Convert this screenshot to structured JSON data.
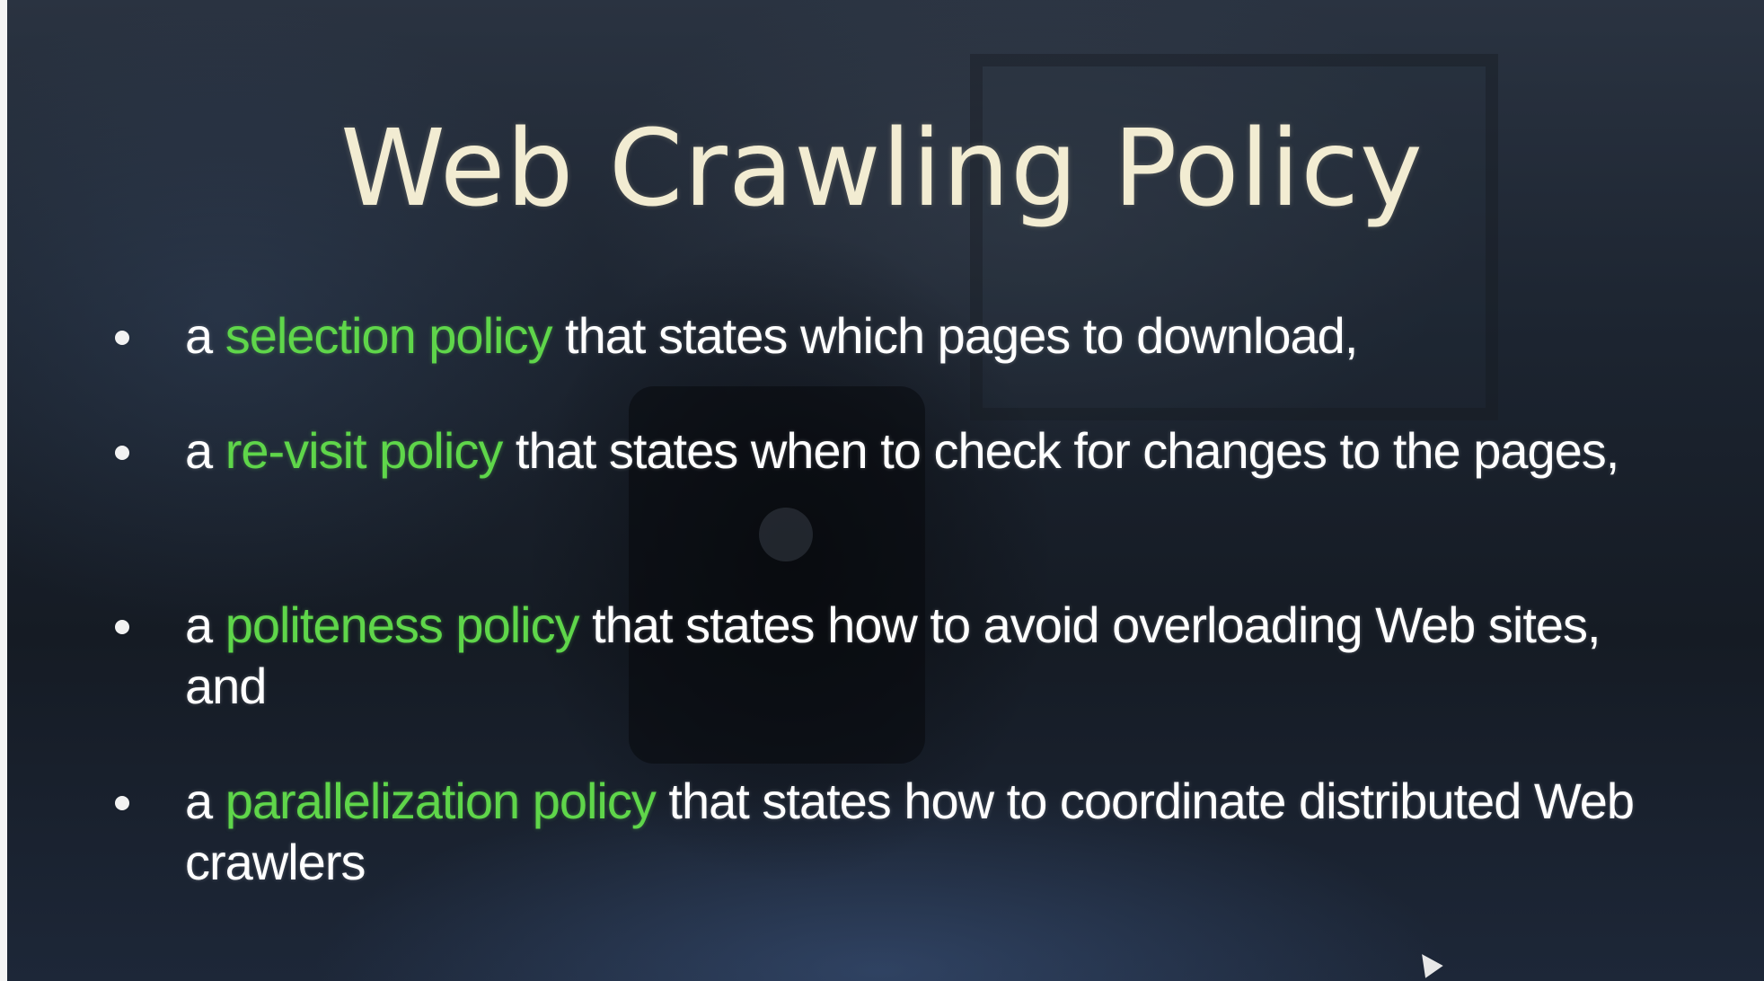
{
  "slide": {
    "title": "Web Crawling Policy",
    "bullets": [
      {
        "prefix": "a ",
        "highlight": "selection policy",
        "rest": " that states which pages to download,"
      },
      {
        "prefix": "a ",
        "highlight": "re-visit policy",
        "rest": " that states when to check for changes to the pages,"
      },
      {
        "prefix": "a ",
        "highlight": "politeness policy",
        "rest": " that states how to avoid overloading Web sites, and"
      },
      {
        "prefix": "a ",
        "highlight": "parallelization policy",
        "rest": " that states how to coordinate distributed Web crawlers"
      }
    ]
  },
  "colors": {
    "title": "#f2ecd2",
    "body_text": "#ffffff",
    "highlight": "#5fd64a",
    "background": "#1c2430"
  },
  "icons": {
    "bullet": "bullet-dot-icon",
    "cursor": "mouse-pointer-icon"
  }
}
